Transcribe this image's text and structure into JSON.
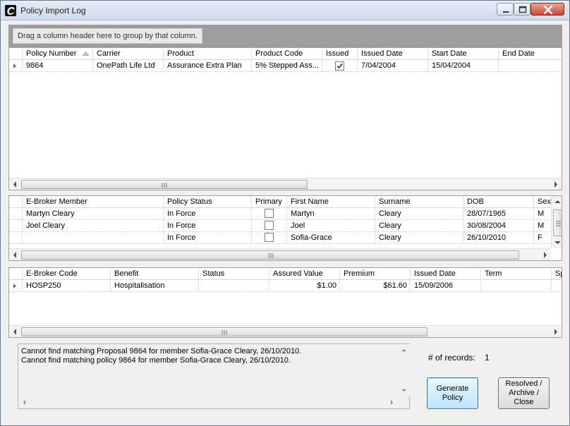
{
  "window": {
    "title": "Policy Import Log"
  },
  "group_panel": {
    "hint": "Drag a column header here to group by that column."
  },
  "policies_grid": {
    "columns": [
      "Policy Number",
      "Carrier",
      "Product",
      "Product Code",
      "Issued",
      "Issued Date",
      "Start Date",
      "End Date"
    ],
    "sorted_column": "Policy Number",
    "rows": [
      {
        "policy_number": "9864",
        "carrier": "OnePath Life Ltd",
        "product": "Assurance Extra Plan",
        "product_code": "5% Stepped Ass...",
        "issued": true,
        "issued_date": "7/04/2004",
        "start_date": "15/04/2004",
        "end_date": ""
      }
    ]
  },
  "members_grid": {
    "columns": [
      "E-Broker Member",
      "Policy Status",
      "Primary",
      "First Name",
      "Surname",
      "DOB",
      "Sex"
    ],
    "rows": [
      {
        "ebroker_member": "Martyn Cleary",
        "policy_status": "In Force",
        "primary": false,
        "first_name": "Martyn",
        "surname": "Cleary",
        "dob": "28/07/1965",
        "sex": "M"
      },
      {
        "ebroker_member": "Joel Cleary",
        "policy_status": "In Force",
        "primary": false,
        "first_name": "Joel",
        "surname": "Cleary",
        "dob": "30/08/2004",
        "sex": "M"
      },
      {
        "ebroker_member": "",
        "policy_status": "In Force",
        "primary": false,
        "first_name": "Sofia-Grace",
        "surname": "Cleary",
        "dob": "26/10/2010",
        "sex": "F"
      }
    ]
  },
  "benefits_grid": {
    "columns": [
      "E-Broker Code",
      "Benefit",
      "Status",
      "Assured Value",
      "Premium",
      "Issued Date",
      "Term",
      "Sp"
    ],
    "rows": [
      {
        "ebroker_code": "HOSP250",
        "benefit": "Hospitalisation",
        "status": "",
        "assured_value": "$1.00",
        "premium": "$61.60",
        "issued_date": "15/09/2006",
        "term": ""
      }
    ]
  },
  "messages": [
    "Cannot find matching Proposal 9864 for member Sofia-Grace Cleary, 26/10/2010.",
    "Cannot find matching policy 9864 for member Sofia-Grace Cleary, 26/10/2010."
  ],
  "records": {
    "label": "# of records:",
    "count": "1"
  },
  "buttons": {
    "generate": "Generate\nPolicy",
    "resolve": "Resolved /\nArchive /\nClose"
  }
}
